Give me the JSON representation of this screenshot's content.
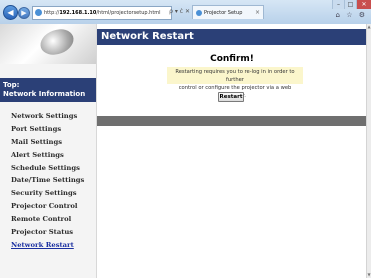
{
  "browser": {
    "back_glyph": "◀",
    "forward_glyph": "▶",
    "url_prefix": "http://",
    "url_host": "192.168.1.10",
    "url_path": "/html/projectorsetup.html",
    "address_tools": "ρ ▾ ċ ✕",
    "tab_title": "Projector Setup",
    "tab_close": "×",
    "win_minimize": "–",
    "win_maximize": "□",
    "win_close": "✕",
    "right_tools": "⌂ ☆ ⚙"
  },
  "sidebar": {
    "top_line1": "Top:",
    "top_line2": "Network Information",
    "items": [
      {
        "label": "Network Settings"
      },
      {
        "label": "Port Settings"
      },
      {
        "label": "Mail Settings"
      },
      {
        "label": "Alert Settings"
      },
      {
        "label": "Schedule Settings"
      },
      {
        "label": "Date/Time Settings"
      },
      {
        "label": "Security Settings"
      },
      {
        "label": "Projector Control"
      },
      {
        "label": "Remote Control"
      },
      {
        "label": "Projector Status"
      },
      {
        "label": "Network Restart"
      }
    ]
  },
  "main": {
    "header": "Network Restart",
    "confirm_title": "Confirm!",
    "message_line1": "Restarting requires you to re-log in in order to further",
    "message_line2": "control or configure the projector via a web browser.",
    "restart_button": "Restart"
  },
  "scrollbar": {
    "up_glyph": "▲",
    "down_glyph": "▼"
  },
  "colors": {
    "header_bg": "#2b4077",
    "message_bg": "#fbf6cc",
    "band": "#6f6f6f",
    "active_link": "#1a2fa0"
  }
}
